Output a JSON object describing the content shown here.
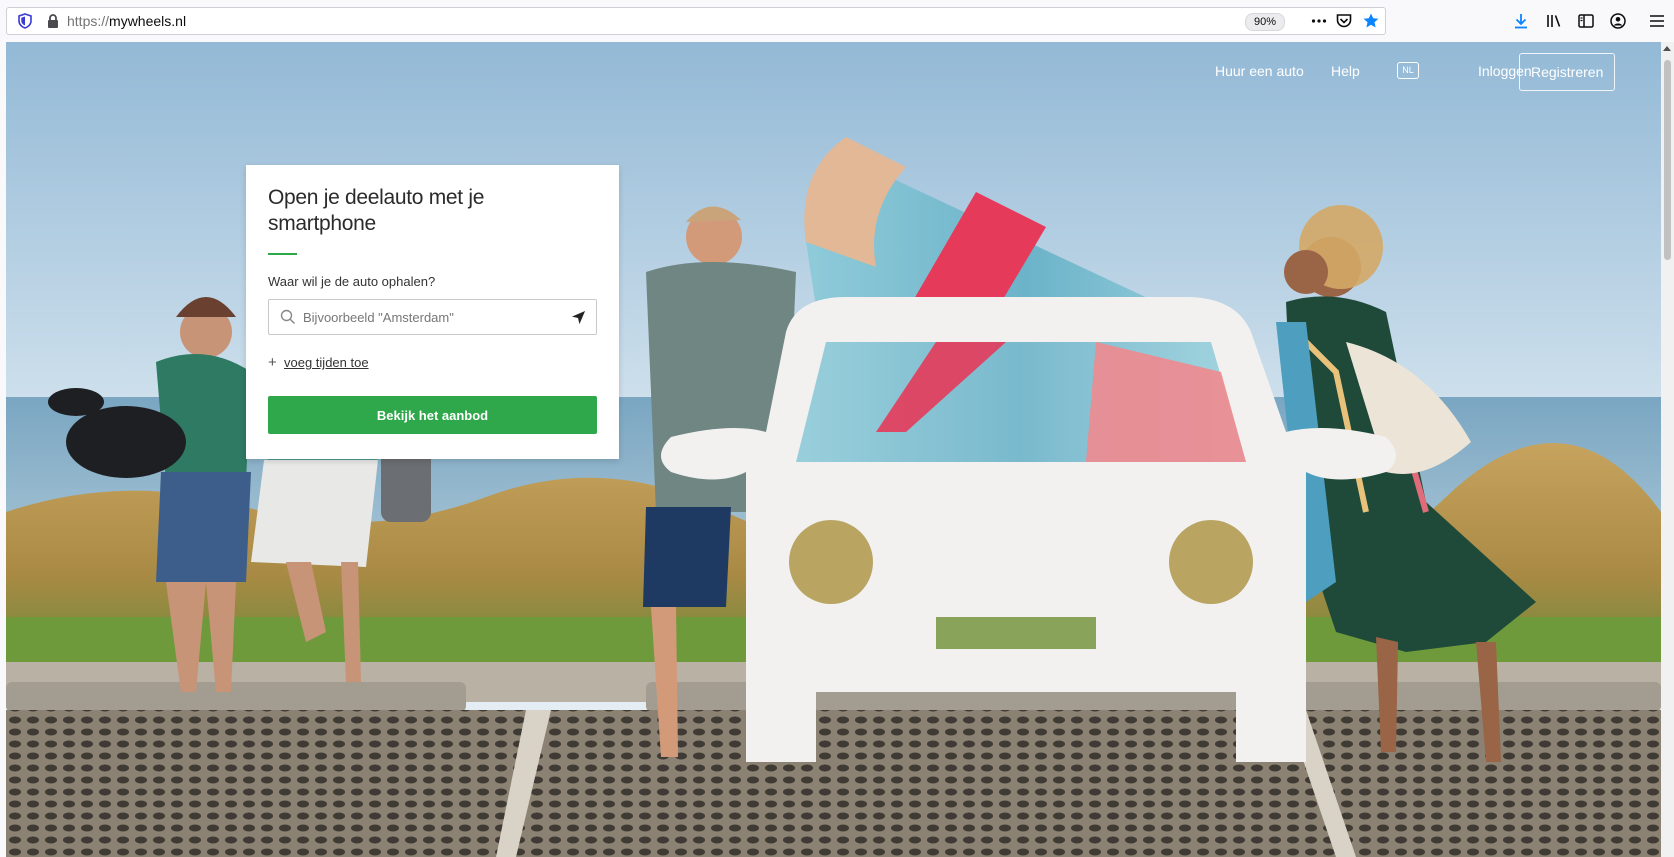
{
  "browser": {
    "url_scheme": "https://",
    "url_host": "mywheels.nl",
    "zoom": "90%",
    "icons": [
      "shield-icon",
      "lock-icon",
      "more-icon",
      "pocket-icon",
      "bookmark-star-icon",
      "download-icon",
      "library-icon",
      "sidebar-icon",
      "account-icon",
      "menu-icon"
    ],
    "accent_color": "#0a84ff"
  },
  "nav": {
    "rent_car": "Huur een auto",
    "help": "Help",
    "language": "NL",
    "login": "Inloggen",
    "register": "Registreren"
  },
  "search_card": {
    "title": "Open je deelauto met je smartphone",
    "location_label": "Waar wil je de auto ophalen?",
    "location_placeholder": "Bijvoorbeeld \"Amsterdam\"",
    "add_times_plus": "+",
    "add_times": "voeg tijden toe",
    "submit": "Bekijk het aanbod",
    "accent_color": "#2ea84b"
  }
}
